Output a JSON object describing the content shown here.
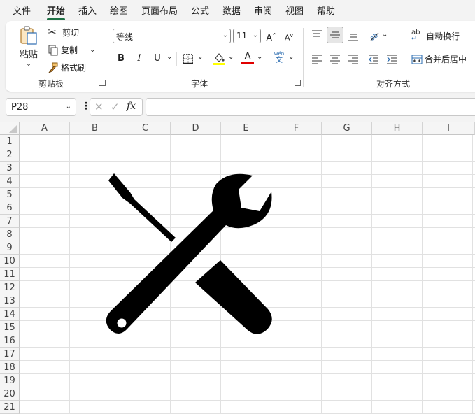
{
  "menu": {
    "tabs": [
      {
        "label": "文件"
      },
      {
        "label": "开始"
      },
      {
        "label": "插入"
      },
      {
        "label": "绘图"
      },
      {
        "label": "页面布局"
      },
      {
        "label": "公式"
      },
      {
        "label": "数据"
      },
      {
        "label": "审阅"
      },
      {
        "label": "视图"
      },
      {
        "label": "帮助"
      }
    ],
    "active_index": 1
  },
  "ribbon": {
    "clipboard": {
      "paste_label": "粘贴",
      "cut_label": "剪切",
      "copy_label": "复制",
      "format_painter_label": "格式刷",
      "group_label": "剪贴板"
    },
    "font": {
      "font_name": "等线",
      "font_size": "11",
      "grow_label": "A",
      "shrink_label": "A",
      "bold_label": "B",
      "italic_label": "I",
      "underline_label": "U",
      "font_color_label": "A",
      "pinyin_top": "wén",
      "pinyin_bottom": "文",
      "group_label": "字体",
      "highlight_color": "#ffff00",
      "font_color": "#e00000"
    },
    "alignment": {
      "wrap_text_label": "自动换行",
      "merge_center_label": "合并后居中",
      "group_label": "对齐方式",
      "wrap_icon_text": "ab"
    }
  },
  "formula_bar": {
    "name_box": "P28",
    "fx_label": "fx",
    "formula": ""
  },
  "sheet": {
    "columns": [
      "A",
      "B",
      "C",
      "D",
      "E",
      "F",
      "G",
      "H",
      "I"
    ],
    "rows": [
      "1",
      "2",
      "3",
      "4",
      "5",
      "6",
      "7",
      "8",
      "9",
      "10",
      "11",
      "12",
      "13",
      "14",
      "15",
      "16",
      "17",
      "18",
      "19",
      "20",
      "21"
    ]
  },
  "colors": {
    "accent": "#1e7145",
    "grid_line": "#e1e1e1",
    "header_bg": "#f5f5f5"
  },
  "icons": {
    "tools_graphic": "wrench-screwdriver-icon"
  }
}
